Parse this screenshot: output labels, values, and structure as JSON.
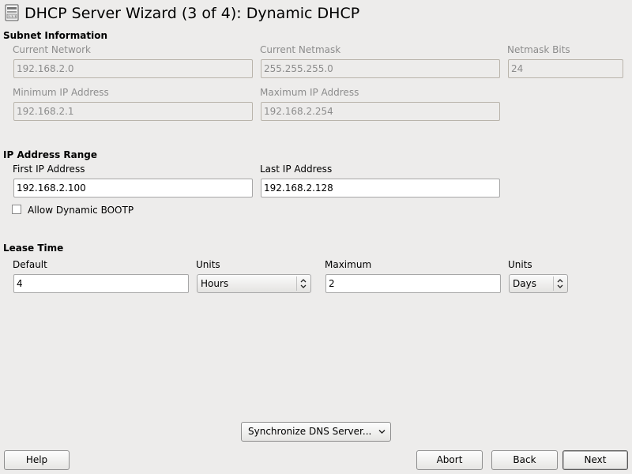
{
  "window": {
    "title": "DHCP Server Wizard (3 of 4): Dynamic DHCP",
    "icon": "dhcp-server-icon"
  },
  "subnet": {
    "heading": "Subnet Information",
    "current_network": {
      "label": "Current Network",
      "value": "192.168.2.0"
    },
    "current_netmask": {
      "label": "Current Netmask",
      "value": "255.255.255.0"
    },
    "netmask_bits": {
      "label": "Netmask Bits",
      "value": "24"
    },
    "minimum_ip": {
      "label": "Minimum IP Address",
      "value": "192.168.2.1"
    },
    "maximum_ip": {
      "label": "Maximum IP Address",
      "value": "192.168.2.254"
    }
  },
  "range": {
    "heading": "IP Address Range",
    "first_ip": {
      "label": "First IP Address",
      "value": "192.168.2.100"
    },
    "last_ip": {
      "label": "Last IP Address",
      "value": "192.168.2.128"
    },
    "allow_bootp": {
      "label": "Allow Dynamic BOOTP",
      "checked": false
    }
  },
  "lease": {
    "heading": "Lease Time",
    "default": {
      "label": "Default",
      "value": "4"
    },
    "default_units": {
      "label": "Units",
      "value": "Hours"
    },
    "maximum": {
      "label": "Maximum",
      "value": "2"
    },
    "maximum_units": {
      "label": "Units",
      "value": "Days"
    }
  },
  "sync_dns": {
    "label": "Synchronize DNS Server..."
  },
  "buttons": {
    "help": "Help",
    "abort": "Abort",
    "back": "Back",
    "next": "Next"
  }
}
